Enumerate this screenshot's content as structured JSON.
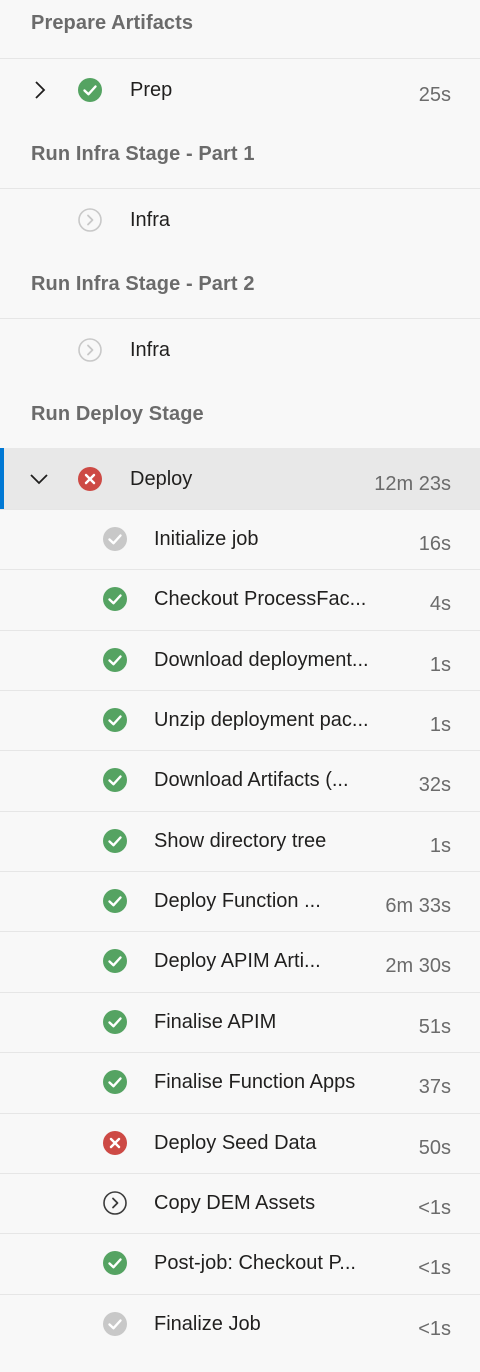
{
  "colors": {
    "success": "#55a362",
    "failure": "#cd4a45",
    "pending": "#c8c8c8",
    "skipped_outline": "#c8c8c8",
    "accent": "#0078d4"
  },
  "stages": [
    {
      "title": "Prepare Artifacts",
      "jobs": [
        {
          "name": "Prep",
          "duration": "25s",
          "status": "success",
          "expand": "collapsed"
        }
      ]
    },
    {
      "title": "Run Infra Stage - Part 1",
      "jobs": [
        {
          "name": "Infra",
          "duration": "",
          "status": "skipped",
          "expand": "none"
        }
      ]
    },
    {
      "title": "Run Infra Stage - Part 2",
      "jobs": [
        {
          "name": "Infra",
          "duration": "",
          "status": "skipped",
          "expand": "none"
        }
      ]
    },
    {
      "title": "Run Deploy Stage",
      "jobs": [
        {
          "name": "Deploy",
          "duration": "12m 23s",
          "status": "failed",
          "expand": "expanded",
          "selected": true,
          "steps": [
            {
              "name": "Initialize job",
              "duration": "16s",
              "status": "pending"
            },
            {
              "name": "Checkout ProcessFac...",
              "duration": "4s",
              "status": "success"
            },
            {
              "name": "Download deployment...",
              "duration": "1s",
              "status": "success"
            },
            {
              "name": "Unzip deployment pac...",
              "duration": "1s",
              "status": "success"
            },
            {
              "name": "Download Artifacts (...",
              "duration": "32s",
              "status": "success"
            },
            {
              "name": "Show directory tree",
              "duration": "1s",
              "status": "success"
            },
            {
              "name": "Deploy Function ...",
              "duration": "6m 33s",
              "status": "success"
            },
            {
              "name": "Deploy APIM Arti...",
              "duration": "2m 30s",
              "status": "success"
            },
            {
              "name": "Finalise APIM",
              "duration": "51s",
              "status": "success"
            },
            {
              "name": "Finalise Function Apps",
              "duration": "37s",
              "status": "success"
            },
            {
              "name": "Deploy Seed Data",
              "duration": "50s",
              "status": "failed"
            },
            {
              "name": "Copy DEM Assets",
              "duration": "<1s",
              "status": "skipped-dark"
            },
            {
              "name": "Post-job: Checkout P...",
              "duration": "<1s",
              "status": "success"
            },
            {
              "name": "Finalize Job",
              "duration": "<1s",
              "status": "pending"
            }
          ]
        }
      ]
    }
  ]
}
